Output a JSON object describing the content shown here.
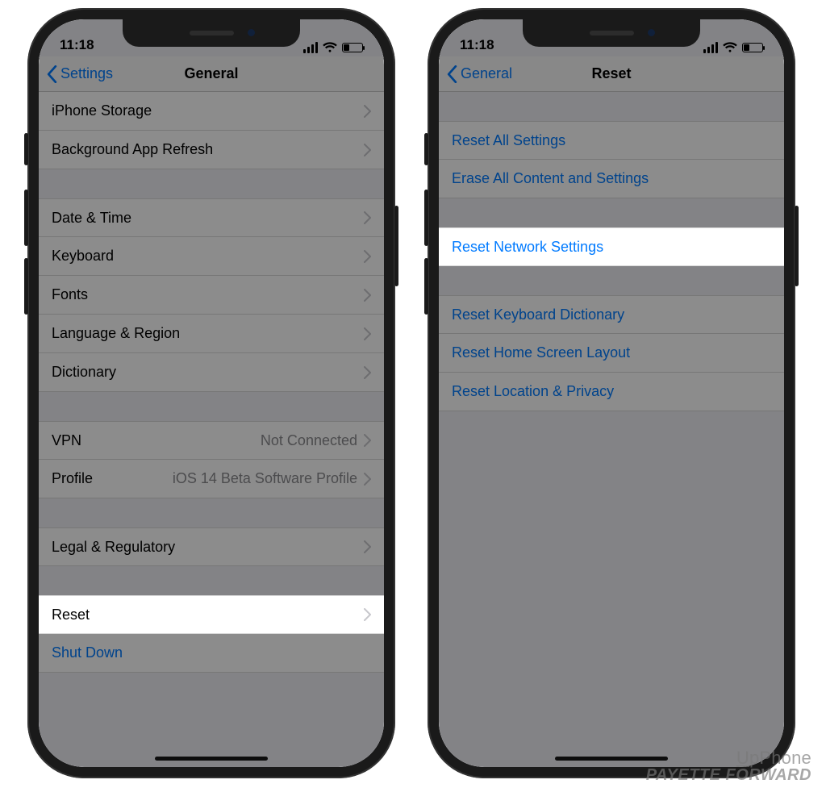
{
  "status": {
    "time": "11:18"
  },
  "left": {
    "back_label": "Settings",
    "title": "General",
    "groups": [
      {
        "first": true,
        "cells": [
          {
            "label": "iPhone Storage",
            "chevron": true
          },
          {
            "label": "Background App Refresh",
            "chevron": true
          }
        ]
      },
      {
        "cells": [
          {
            "label": "Date & Time",
            "chevron": true
          },
          {
            "label": "Keyboard",
            "chevron": true
          },
          {
            "label": "Fonts",
            "chevron": true
          },
          {
            "label": "Language & Region",
            "chevron": true
          },
          {
            "label": "Dictionary",
            "chevron": true
          }
        ]
      },
      {
        "cells": [
          {
            "label": "VPN",
            "detail": "Not Connected",
            "chevron": true
          },
          {
            "label": "Profile",
            "detail": "iOS 14 Beta Software Profile",
            "chevron": true
          }
        ]
      },
      {
        "cells": [
          {
            "label": "Legal & Regulatory",
            "chevron": true
          }
        ]
      },
      {
        "cells": [
          {
            "label": "Reset",
            "chevron": true,
            "highlight": true
          },
          {
            "label": "Shut Down",
            "action": true
          }
        ]
      }
    ]
  },
  "right": {
    "back_label": "General",
    "title": "Reset",
    "groups": [
      {
        "cells": [
          {
            "label": "Reset All Settings",
            "link": true
          },
          {
            "label": "Erase All Content and Settings",
            "link": true
          }
        ]
      },
      {
        "cells": [
          {
            "label": "Reset Network Settings",
            "link": true,
            "highlight": true
          }
        ]
      },
      {
        "cells": [
          {
            "label": "Reset Keyboard Dictionary",
            "link": true
          },
          {
            "label": "Reset Home Screen Layout",
            "link": true
          },
          {
            "label": "Reset Location & Privacy",
            "link": true
          }
        ]
      }
    ]
  },
  "watermark": {
    "line1_a": "U",
    "line1_b": "p",
    "line1_c": "Phone",
    "line2": "PAYETTE FORWARD"
  }
}
